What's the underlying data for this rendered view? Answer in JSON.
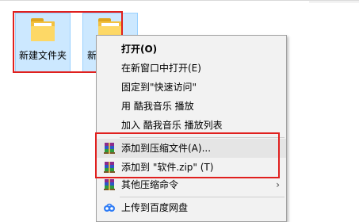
{
  "folders": [
    {
      "name": "新建文件夹"
    },
    {
      "name": "新"
    }
  ],
  "context_menu": {
    "items": [
      {
        "label": "打开(O)"
      },
      {
        "label": "在新窗口中打开(E)"
      },
      {
        "label": "固定到\"快速访问\""
      },
      {
        "label": "用 酷我音乐 播放"
      },
      {
        "label": "加入 酷我音乐 播放列表"
      },
      {
        "label": "添加到压缩文件(A)...",
        "icon": "winrar-archive-icon"
      },
      {
        "label": "添加到 \"软件.zip\" (T)",
        "icon": "winrar-archive-icon"
      },
      {
        "label": "其他压缩命令",
        "icon": "winrar-archive-icon",
        "submenu_icon": "chevron-right-icon"
      },
      {
        "label": "上传到百度网盘",
        "icon": "baidu-netdisk-icon"
      }
    ]
  },
  "colors": {
    "highlight_box": "#e0201e",
    "selection_bg": "#cce8ff",
    "folder_yellow": "#f3c13f"
  }
}
